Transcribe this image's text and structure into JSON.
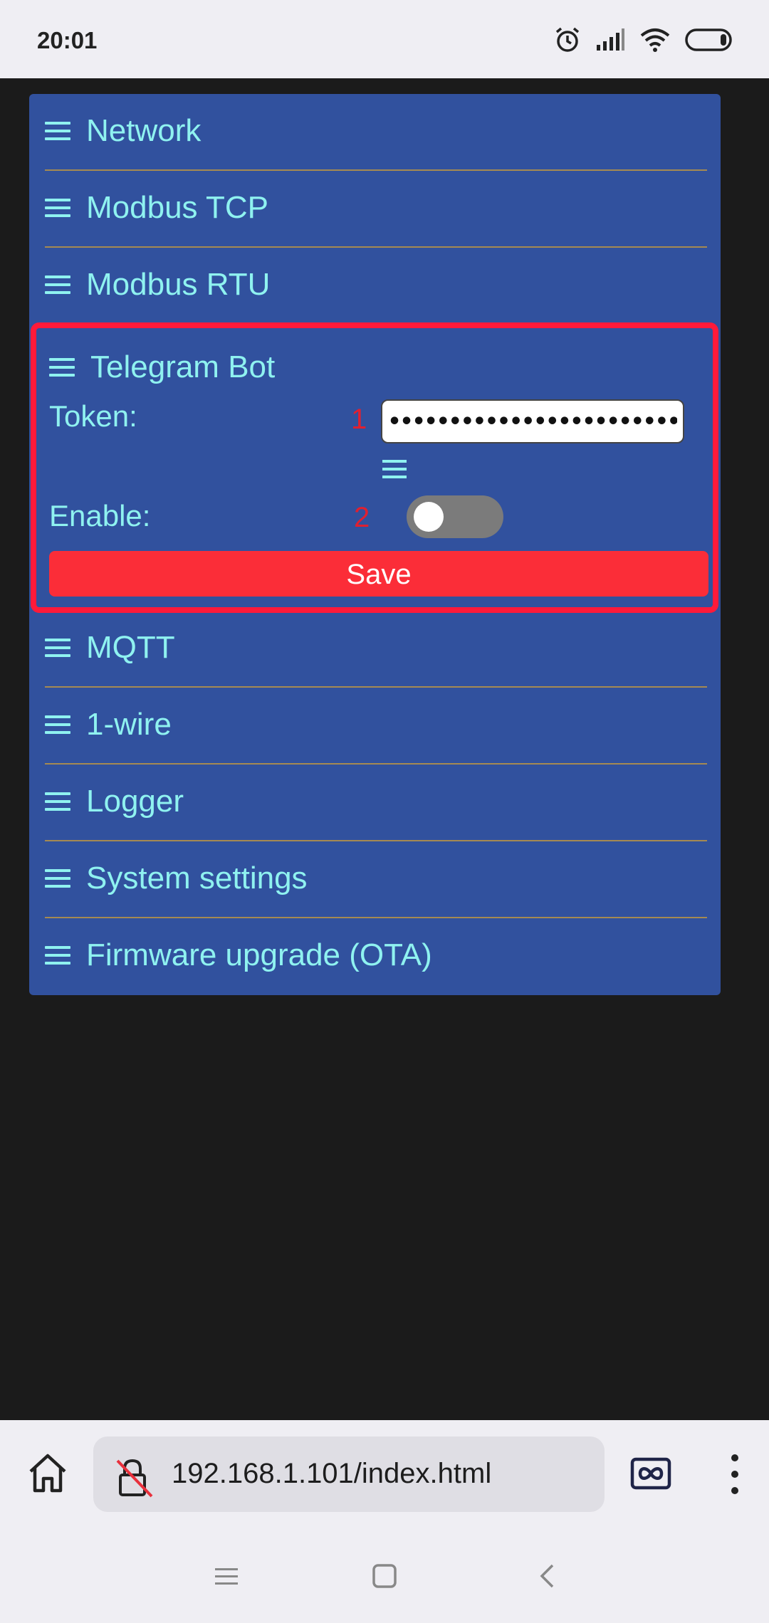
{
  "status_bar": {
    "time": "20:01",
    "icons": [
      "alarm-icon",
      "signal-icon",
      "wifi-icon",
      "battery-icon"
    ]
  },
  "menu": {
    "items_top": [
      {
        "label": "Network"
      },
      {
        "label": "Modbus TCP"
      },
      {
        "label": "Modbus RTU"
      }
    ],
    "telegram": {
      "title": "Telegram Bot",
      "token_label": "Token:",
      "token_value": "••••••••••••••••••••••••••••••••••••",
      "marker_1": "1",
      "enable_label": "Enable:",
      "marker_2": "2",
      "enabled": false,
      "save_label": "Save"
    },
    "items_bottom": [
      {
        "label": "MQTT"
      },
      {
        "label": "1-wire"
      },
      {
        "label": "Logger"
      },
      {
        "label": "System settings"
      },
      {
        "label": "Firmware upgrade (OTA)"
      }
    ]
  },
  "browser": {
    "url": "192.168.1.101/index.html"
  },
  "colors": {
    "panel": "#31519e",
    "text": "#8ff2f0",
    "highlight": "#ff1a3a",
    "save": "#fb2d38"
  }
}
